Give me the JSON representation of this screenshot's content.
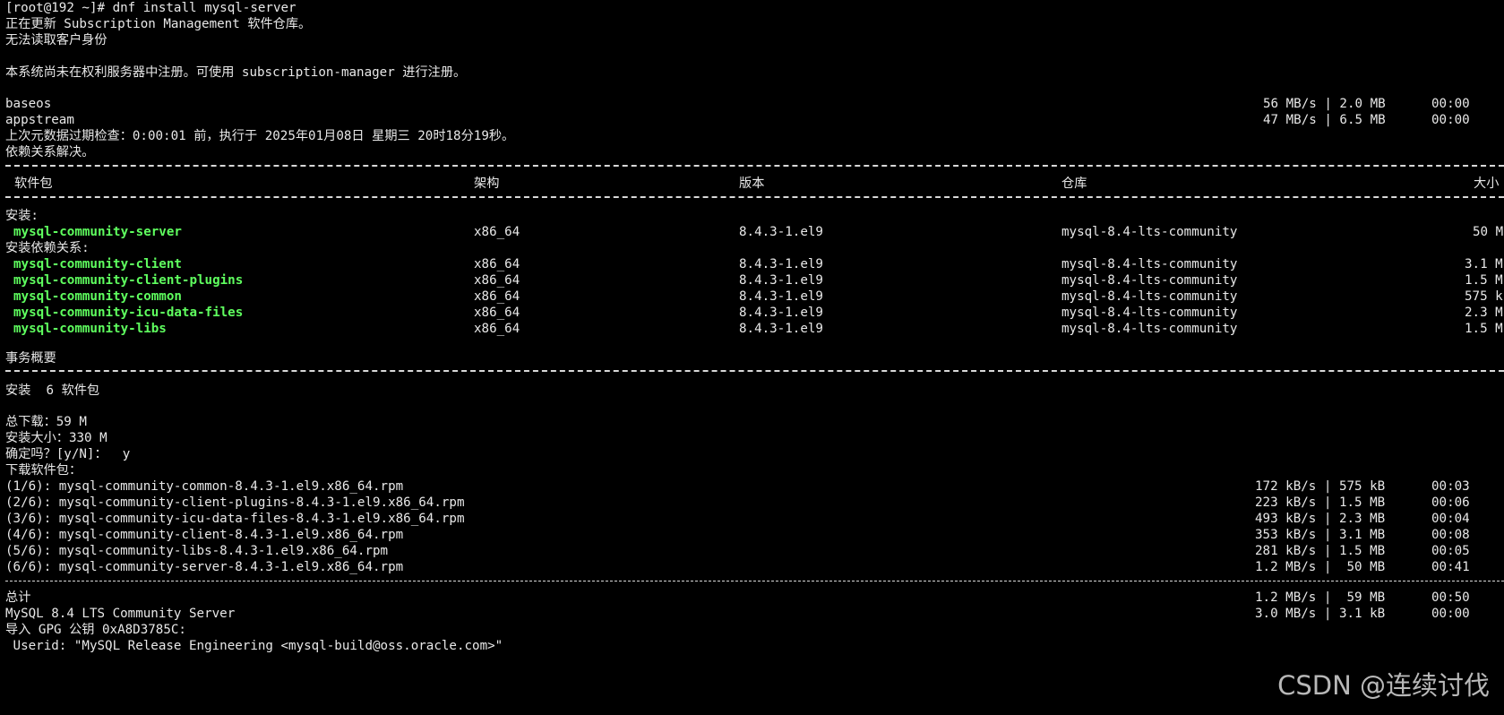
{
  "terminal": {
    "prompt_line": "[root@192 ~]# dnf install mysql-server",
    "update_line": "正在更新 Subscription Management 软件仓库。",
    "identity_line": "无法读取客户身份",
    "register_line": "本系统尚未在权利服务器中注册。可使用 subscription-manager 进行注册。",
    "repos": [
      {
        "name": "baseos",
        "speed": "56 MB/s | 2.0 MB",
        "time": "00:00"
      },
      {
        "name": "appstream",
        "speed": "47 MB/s | 6.5 MB",
        "time": "00:00"
      }
    ],
    "metadata_line": "上次元数据过期检查：0:00:01 前，执行于 2025年01月08日 星期三 20时18分19秒。",
    "deps_resolved": "依赖关系解决。",
    "table": {
      "headers": {
        "package": "软件包",
        "arch": "架构",
        "version": "版本",
        "repo": "仓库",
        "size": "大小"
      },
      "install_label": "安装:",
      "deps_label": "安装依赖关系:",
      "install_rows": [
        {
          "name": "mysql-community-server",
          "arch": "x86_64",
          "version": "8.4.3-1.el9",
          "repo": "mysql-8.4-lts-community",
          "size": "50 M"
        }
      ],
      "dep_rows": [
        {
          "name": "mysql-community-client",
          "arch": "x86_64",
          "version": "8.4.3-1.el9",
          "repo": "mysql-8.4-lts-community",
          "size": "3.1 M"
        },
        {
          "name": "mysql-community-client-plugins",
          "arch": "x86_64",
          "version": "8.4.3-1.el9",
          "repo": "mysql-8.4-lts-community",
          "size": "1.5 M"
        },
        {
          "name": "mysql-community-common",
          "arch": "x86_64",
          "version": "8.4.3-1.el9",
          "repo": "mysql-8.4-lts-community",
          "size": "575 k"
        },
        {
          "name": "mysql-community-icu-data-files",
          "arch": "x86_64",
          "version": "8.4.3-1.el9",
          "repo": "mysql-8.4-lts-community",
          "size": "2.3 M"
        },
        {
          "name": "mysql-community-libs",
          "arch": "x86_64",
          "version": "8.4.3-1.el9",
          "repo": "mysql-8.4-lts-community",
          "size": "1.5 M"
        }
      ]
    },
    "summary_title": "事务概要",
    "install_summary": "安装  6 软件包",
    "total_download": "总下载：59 M",
    "install_size": "安装大小：330 M",
    "confirm_prompt": "确定吗？[y/N]：  y",
    "downloading_label": "下载软件包：",
    "downloads": [
      {
        "file": "(1/6): mysql-community-common-8.4.3-1.el9.x86_64.rpm",
        "speed": "172 kB/s | 575 kB",
        "time": "00:03"
      },
      {
        "file": "(2/6): mysql-community-client-plugins-8.4.3-1.el9.x86_64.rpm",
        "speed": "223 kB/s | 1.5 MB",
        "time": "00:06"
      },
      {
        "file": "(3/6): mysql-community-icu-data-files-8.4.3-1.el9.x86_64.rpm",
        "speed": "493 kB/s | 2.3 MB",
        "time": "00:04"
      },
      {
        "file": "(4/6): mysql-community-client-8.4.3-1.el9.x86_64.rpm",
        "speed": "353 kB/s | 3.1 MB",
        "time": "00:08"
      },
      {
        "file": "(5/6): mysql-community-libs-8.4.3-1.el9.x86_64.rpm",
        "speed": "281 kB/s | 1.5 MB",
        "time": "00:05"
      },
      {
        "file": "(6/6): mysql-community-server-8.4.3-1.el9.x86_64.rpm",
        "speed": "1.2 MB/s |  50 MB",
        "time": "00:41"
      }
    ],
    "totals": [
      {
        "label": "总计",
        "speed": "1.2 MB/s |  59 MB",
        "time": "00:50"
      },
      {
        "label": "MySQL 8.4 LTS Community Server",
        "speed": "3.0 MB/s | 3.1 kB",
        "time": "00:00"
      }
    ],
    "gpg_line": "导入 GPG 公钥 0xA8D3785C:",
    "userid_line": " Userid: \"MySQL Release Engineering <mysql-build@oss.oracle.com>\""
  },
  "watermark": "CSDN @连续讨伐",
  "colors": {
    "background": "#000000",
    "text": "#e8e8e8",
    "package_name": "#5fff5f"
  }
}
